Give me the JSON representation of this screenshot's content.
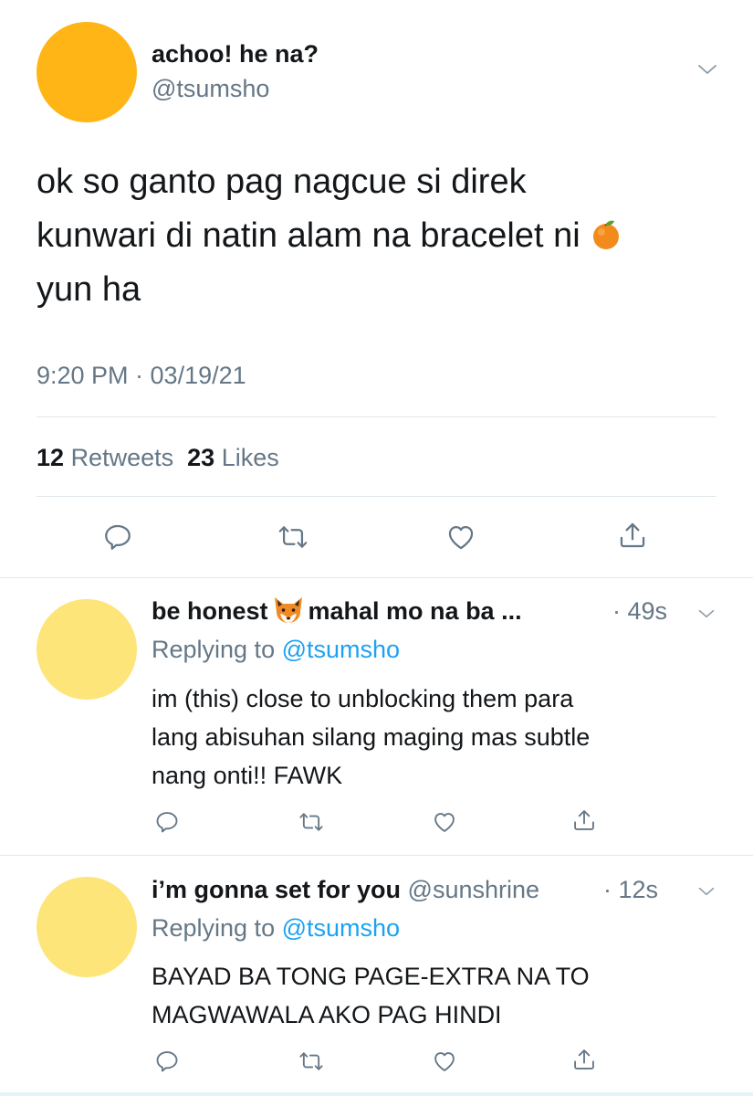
{
  "main_tweet": {
    "display_name": "achoo! he na?",
    "handle": "@tsumsho",
    "text_line1": "ok so ganto pag nagcue si direk",
    "text_line2": "kunwari di natin alam na bracelet ni",
    "text_line3": "yun ha",
    "emoji": "orange-emoji",
    "timestamp": "9:20 PM · 03/19/21",
    "retweets_count": "12",
    "retweets_label": "Retweets",
    "likes_count": "23",
    "likes_label": "Likes"
  },
  "replies": [
    {
      "name_part1": "be honest",
      "emoji": "fox-emoji",
      "name_part2": "mahal mo na ba ...",
      "time": "· 49s",
      "replying_prefix": "Replying to",
      "replying_handle": "@tsumsho",
      "body_line1": "im (this) close to unblocking them para",
      "body_line2": "lang abisuhan silang maging mas subtle",
      "body_line3": "nang onti!! FAWK"
    },
    {
      "name": "i’m gonna set for you",
      "handle": "@sunshrine",
      "time": "· 12s",
      "replying_prefix": "Replying to",
      "replying_handle": "@tsumsho",
      "body_line1": "BAYAD BA TONG PAGE-EXTRA NA TO",
      "body_line2": "MAGWAWALA AKO PAG HINDI"
    }
  ],
  "icons": [
    "chevron-down-icon",
    "reply-icon",
    "retweet-icon",
    "like-icon",
    "share-icon"
  ],
  "colors": {
    "link": "#1da1f2",
    "secondary_text": "#657786",
    "main_avatar": "#ffb515",
    "reply_avatar": "#fde57a",
    "divider": "#e1e8ed"
  }
}
